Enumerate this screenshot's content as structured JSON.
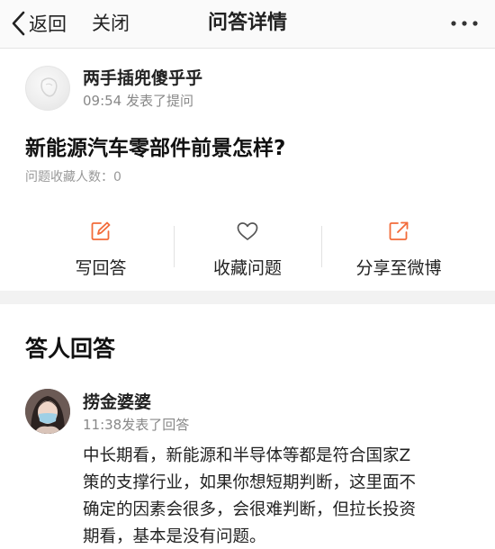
{
  "navbar": {
    "back_label": "返回",
    "close_label": "关闭",
    "title": "问答详情"
  },
  "question": {
    "asker": {
      "name": "两手插兜傻乎乎",
      "meta": "09:54 发表了提问"
    },
    "title": "新能源汽车零部件前景怎样?",
    "favorite_count_text": "问题收藏人数：0",
    "actions": {
      "write_answer": "写回答",
      "favorite": "收藏问题",
      "share": "分享至微博"
    }
  },
  "answers": {
    "heading": "答人回答",
    "items": [
      {
        "name": "捞金婆婆",
        "meta": "11:38发表了回答",
        "body_lines": [
          "中长期看，新能源和半导体等都是符合国家Z",
          "策的支撑行业，如果你想短期判断，这里面不",
          "确定的因素会很多，会很难判断，但拉长投资",
          "期看，基本是没有问题。"
        ]
      }
    ]
  },
  "colors": {
    "accent": "#f26b3a",
    "text": "#222222",
    "muted": "#888888",
    "band": "#f2f2f2"
  },
  "icons": {
    "back": "chevron-left-icon",
    "more": "more-dots-icon",
    "write": "edit-icon",
    "favorite": "heart-icon",
    "share": "share-out-icon"
  }
}
